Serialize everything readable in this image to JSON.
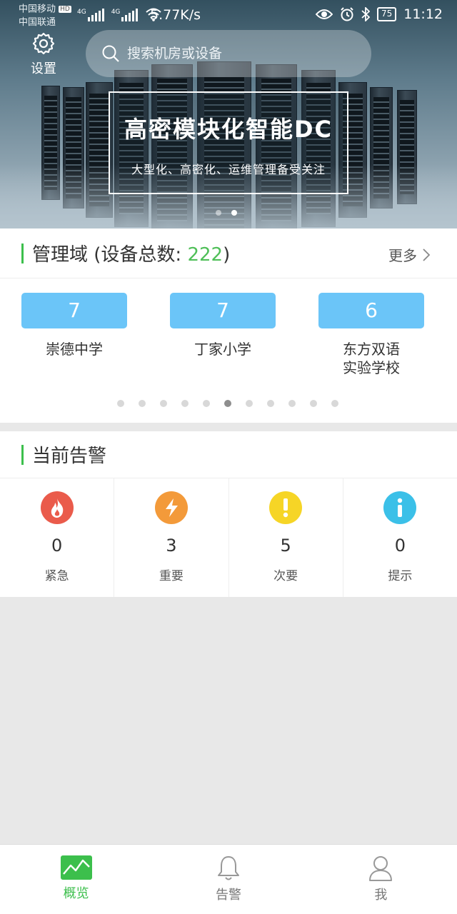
{
  "status_bar": {
    "carrier1": "中国移动",
    "carrier2": "中国联通",
    "hd": "HD",
    "net1": "4G",
    "net2": "4G",
    "speed": "5.77K/s",
    "battery": "75",
    "time": "11:12"
  },
  "header": {
    "settings_label": "设置",
    "search_placeholder": "搜索机房或设备"
  },
  "banner": {
    "title": "高密模块化智能DC",
    "subtitle": "大型化、高密化、运维管理备受关注",
    "page_count": 2,
    "active_page": 1
  },
  "domain_section": {
    "title_prefix": "管理域 (设备总数: ",
    "total": "222",
    "title_suffix": ")",
    "more_label": "更多",
    "items": [
      {
        "count": "7",
        "name": "崇德中学"
      },
      {
        "count": "7",
        "name": "丁家小学"
      },
      {
        "count": "6",
        "name": "东方双语\n实验学校"
      }
    ],
    "page_count": 11,
    "active_page": 5
  },
  "alarm_section": {
    "title": "当前告警",
    "items": [
      {
        "icon": "fire-icon",
        "color": "#ea5b4b",
        "count": "0",
        "label": "紧急"
      },
      {
        "icon": "lightning-icon",
        "color": "#f39a3a",
        "count": "3",
        "label": "重要"
      },
      {
        "icon": "exclamation-icon",
        "color": "#f6d526",
        "count": "5",
        "label": "次要"
      },
      {
        "icon": "info-icon",
        "color": "#3bc0e8",
        "count": "0",
        "label": "提示"
      }
    ]
  },
  "tabbar": {
    "tabs": [
      {
        "label": "概览",
        "icon": "overview-chart-icon",
        "active": true
      },
      {
        "label": "告警",
        "icon": "bell-icon",
        "active": false
      },
      {
        "label": "我",
        "icon": "user-icon",
        "active": false
      }
    ]
  },
  "colors": {
    "accent_green": "#3cbf4c",
    "tile_blue": "#6bc5f8"
  }
}
